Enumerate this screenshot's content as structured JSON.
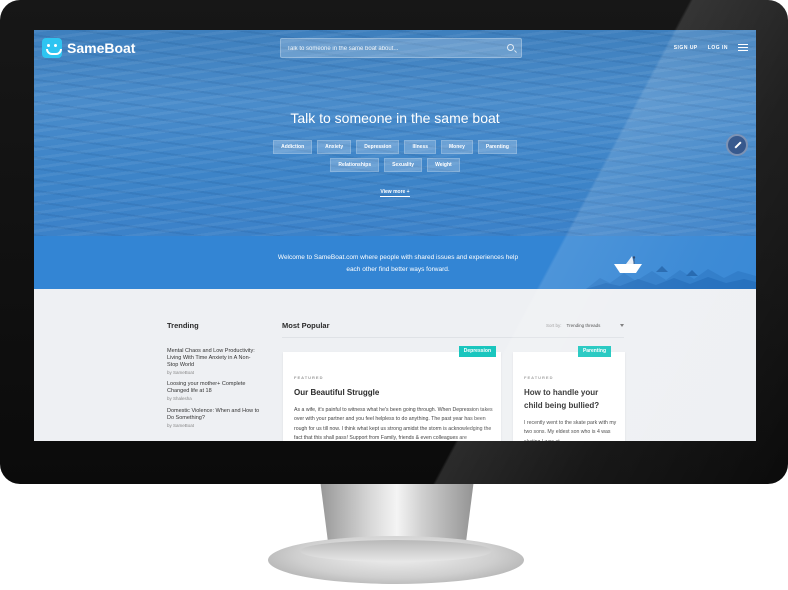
{
  "brand": {
    "name": "SameBoat"
  },
  "search": {
    "placeholder": "Talk to someone in the same boat about..."
  },
  "nav": {
    "sign_up": "SIGN UP",
    "log_in": "LOG IN"
  },
  "hero": {
    "title": "Talk to someone in the same boat",
    "tags_row1": [
      "Addiction",
      "Anxiety",
      "Depression",
      "Illness",
      "Money",
      "Parenting"
    ],
    "tags_row2": [
      "Relationships",
      "Sexuality",
      "Weight"
    ],
    "view_more": "View more +"
  },
  "welcome": {
    "line1": "Welcome to SameBoat.com where people with shared issues and experiences help",
    "line2": "each other find better ways forward."
  },
  "trending": {
    "title": "Trending",
    "items": [
      {
        "title_lines": [
          "Mental Chaos and Low Productivity:",
          "Living With Time Anxiety in A Non-",
          "Stop World"
        ],
        "by": "by SameBoat"
      },
      {
        "title_lines": [
          "Loosing your mother+ Complete",
          "Changed life at 18"
        ],
        "by": "by Shalesha"
      },
      {
        "title_lines": [
          "Domestic Violence: When and How to",
          "Do Something?"
        ],
        "by": "by SameBoat"
      }
    ]
  },
  "popular": {
    "title": "Most Popular",
    "sort_label": "Sort by:",
    "sort_value": "Trending threads",
    "cards": [
      {
        "badge": "Depression",
        "featured": "FEATURED",
        "title": "Our Beautiful Struggle",
        "body": "As a wife, it's painful to witness what he's been going through. When Depression takes over with your partner and you feel helpless to do anything. The past year has been rough for us till now. I think what kept us strong amidst the storm is acknowledging the fact that this shall pass! Support from Family, friends & even colleagues are overwhelming. When life hits us hard. We are not Alone! Here's my"
      },
      {
        "badge": "Parenting",
        "featured": "FEATURED",
        "title": "How to handle your child being bullied?",
        "body": "I recently went to the skate park with my two sons. My eldest son who is 4 was skating I was at"
      }
    ]
  },
  "colors": {
    "hero_blue": "#4a8ccb",
    "band_blue": "#3385d4",
    "badge_teal": "#19c6be",
    "logo_cyan": "#2ec4f1",
    "fab_navy": "#2a4e86"
  },
  "icons": [
    "logo-icon",
    "search-icon",
    "menu-icon",
    "pencil-icon",
    "paper-boat-icon"
  ]
}
